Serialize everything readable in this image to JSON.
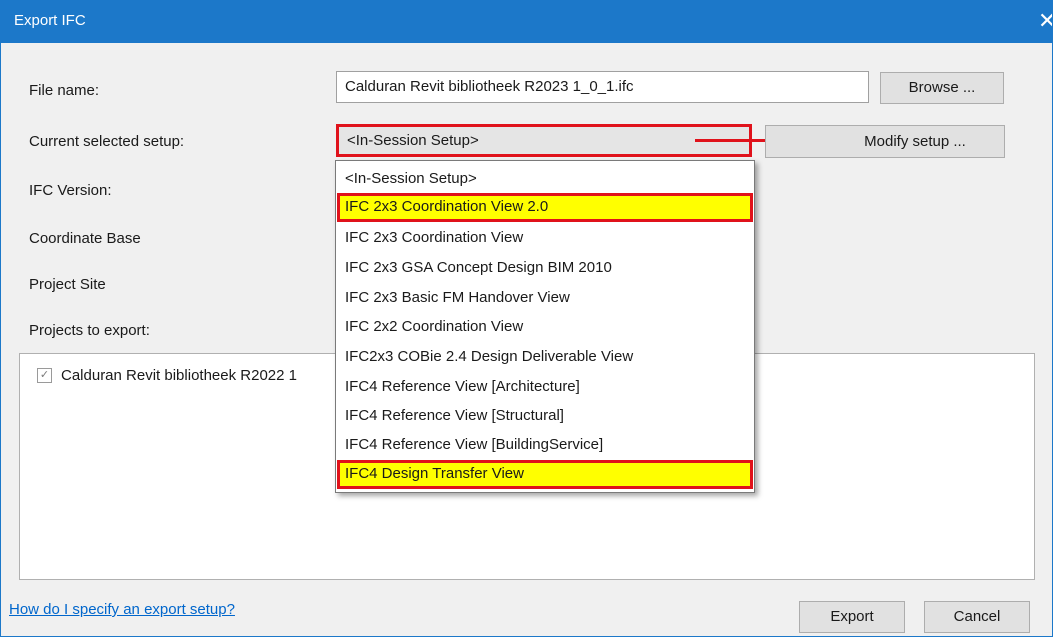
{
  "window": {
    "title": "Export IFC",
    "close_glyph": "✕"
  },
  "form": {
    "file_name_label": "File name:",
    "file_name_value": "Calduran Revit bibliotheek R2023 1_0_1.ifc",
    "browse_label": "Browse ...",
    "setup_label": "Current selected setup:",
    "setup_value": "<In-Session Setup>",
    "modify_label": "Modify setup ...",
    "ifc_version_label": "IFC Version:",
    "coord_base_label": "Coordinate Base",
    "project_site_label": "Project Site",
    "projects_label": "Projects to export:"
  },
  "projects": [
    {
      "name": "Calduran Revit bibliotheek R2022 1",
      "checked": true
    }
  ],
  "dropdown": {
    "items": [
      "<In-Session Setup>",
      "IFC 2x3 Coordination View 2.0",
      "IFC 2x3 Coordination View",
      "IFC 2x3 GSA Concept Design BIM 2010",
      "IFC 2x3 Basic FM Handover View",
      "IFC 2x2 Coordination View",
      "IFC2x3 COBie 2.4 Design Deliverable View",
      "IFC4 Reference View [Architecture]",
      "IFC4 Reference View [Structural]",
      "IFC4 Reference View [BuildingService]",
      "IFC4 Design Transfer View"
    ],
    "highlighted": [
      1,
      10
    ]
  },
  "footer": {
    "help_link": "How do I specify an export setup?",
    "export_label": "Export",
    "cancel_label": "Cancel"
  },
  "colors": {
    "titlebar": "#1c78c9",
    "annotation_red": "#e0121b",
    "highlight_yellow": "#ffff00",
    "link": "#0066cc"
  },
  "icons": {
    "close": "close-icon",
    "check": "checkmark-icon"
  }
}
